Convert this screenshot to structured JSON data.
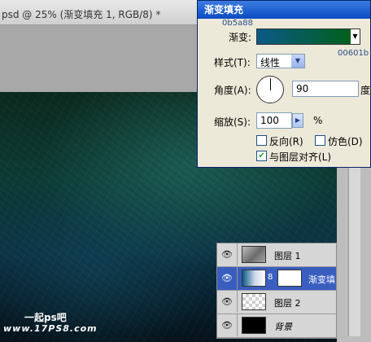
{
  "document": {
    "title": "psd @ 25% (渐变填充 1, RGB/8) *"
  },
  "dialog": {
    "title": "渐变填充",
    "gradient_label": "渐变:",
    "gradient_start_hex": "0b5a88",
    "gradient_end_hex": "00601b",
    "style_label": "样式(T):",
    "style_value": "线性",
    "angle_label": "角度(A):",
    "angle_value": "90",
    "angle_unit": "度",
    "scale_label": "缩放(S):",
    "scale_value": "100",
    "scale_unit": "%",
    "reverse_label": "反向(R)",
    "reverse_checked": false,
    "dither_label": "仿色(D)",
    "dither_checked": false,
    "align_label": "与图层对齐(L)",
    "align_checked": true,
    "colors": {
      "start": "#0b5a88",
      "end": "#00601b"
    }
  },
  "layers": {
    "items": [
      {
        "name": "图层 1",
        "visible": true,
        "selected": false
      },
      {
        "name": "渐变填",
        "visible": true,
        "selected": true
      },
      {
        "name": "图层 2",
        "visible": true,
        "selected": false
      },
      {
        "name": "背景",
        "visible": true,
        "selected": false
      }
    ]
  },
  "watermark": {
    "line1": "一起ps吧",
    "line2": "www.17PS8.com"
  }
}
